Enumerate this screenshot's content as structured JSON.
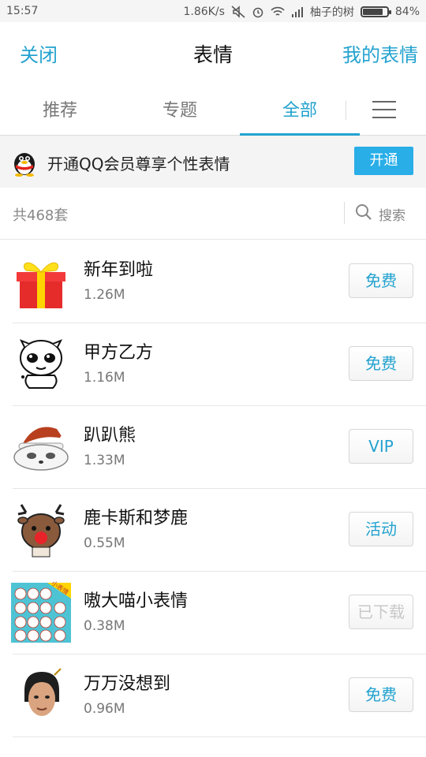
{
  "status_bar": {
    "time": "15:57",
    "speed": "1.86K/s",
    "carrier": "柚子的树",
    "battery": "84%",
    "battery_level": 0.84
  },
  "topnav": {
    "close_label": "关闭",
    "title": "表情",
    "my_label": "我的表情"
  },
  "tabs": [
    {
      "label": "推荐"
    },
    {
      "label": "专题"
    },
    {
      "label": "全部"
    }
  ],
  "banner": {
    "text": "开通QQ会员尊享个性表情",
    "button_label": "开通"
  },
  "count": {
    "text": "共468套",
    "search_label": "搜索"
  },
  "items": [
    {
      "name": "新年到啦",
      "size": "1.26M",
      "action": "免费"
    },
    {
      "name": "甲方乙方",
      "size": "1.16M",
      "action": "免费"
    },
    {
      "name": "趴趴熊",
      "size": "1.33M",
      "action": "VIP"
    },
    {
      "name": "鹿卡斯和梦鹿",
      "size": "0.55M",
      "action": "活动"
    },
    {
      "name": "嗷大喵小表情",
      "size": "0.38M",
      "action": "已下载",
      "thumb_tag": "小表情"
    },
    {
      "name": "万万没想到",
      "size": "0.96M",
      "action": "免费"
    }
  ],
  "colors": {
    "accent": "#23a2cf",
    "banner_button": "#29aee8"
  }
}
